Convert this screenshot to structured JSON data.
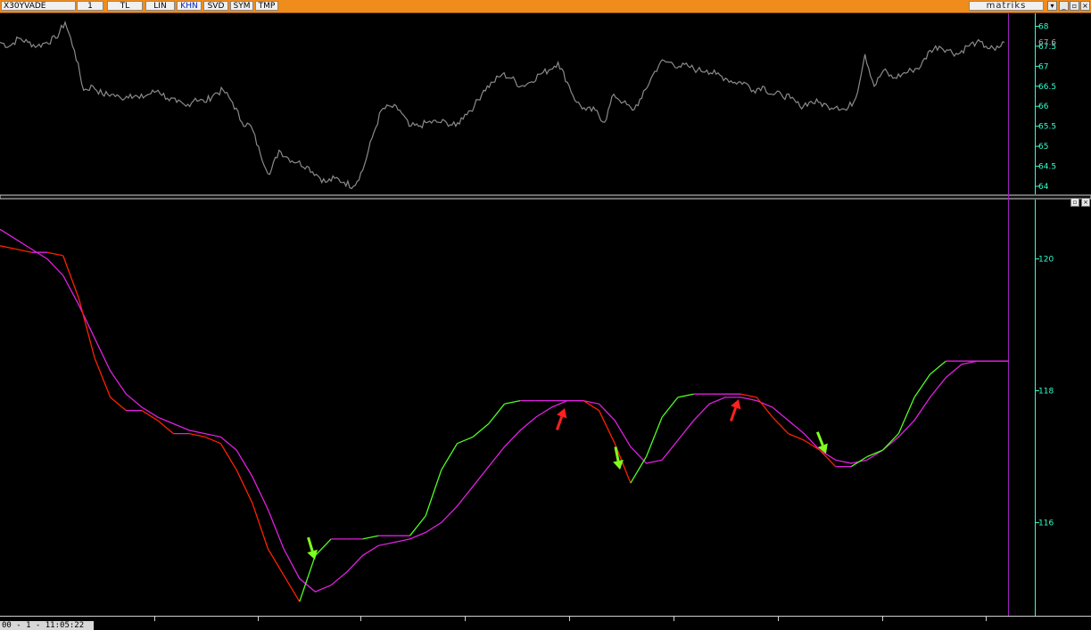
{
  "toolbar": {
    "symbol": "X30YVADE",
    "interval": "1",
    "buttons": [
      "TL",
      "LIN",
      "KHN",
      "SVD",
      "SYM",
      "TMP"
    ],
    "active_button": "KHN",
    "brand": "matriks",
    "win_buttons": [
      "▾",
      "_",
      "▫",
      "×"
    ]
  },
  "status": {
    "text": "00 - 1 - 11:05:22"
  },
  "pane_controls": [
    "▫",
    "×"
  ],
  "colors": {
    "background": "#000000",
    "toolbar": "#f08c1c",
    "price_line": "#8a8a8a",
    "axis": "#33ffcc",
    "magenta": "#e020e0",
    "up_line": "#50ff20",
    "down_line": "#ff2000",
    "arrow_green": "#80ff20",
    "arrow_red": "#ff2020"
  },
  "chart_data": [
    {
      "type": "line",
      "title": "",
      "ylim": [
        63.8,
        68.3
      ],
      "y_ticks": [
        68,
        67.5,
        67,
        66.5,
        66,
        65.5,
        65,
        64.5,
        64
      ],
      "last_value": "67.6",
      "grid": false,
      "series": [
        {
          "values": [
            67.6,
            67.5,
            67.7,
            67.6,
            67.5,
            67.6,
            67.7,
            68.1,
            67.4,
            66.4,
            66.5,
            66.3,
            66.3,
            66.2,
            66.3,
            66.2,
            66.3,
            66.4,
            66.2,
            66.1,
            66.0,
            66.2,
            66.1,
            66.3,
            66.4,
            66.1,
            65.6,
            65.5,
            64.8,
            64.3,
            64.9,
            64.7,
            64.6,
            64.5,
            64.3,
            64.1,
            64.2,
            64.1,
            64.0,
            64.4,
            65.2,
            65.9,
            66.0,
            65.9,
            65.5,
            65.5,
            65.6,
            65.6,
            65.6,
            65.5,
            65.8,
            66.0,
            66.4,
            66.6,
            66.8,
            66.7,
            66.5,
            66.6,
            66.8,
            66.9,
            67.1,
            66.6,
            66.1,
            65.9,
            65.9,
            65.6,
            66.3,
            66.1,
            65.9,
            66.2,
            66.7,
            67.1,
            67.1,
            67.0,
            67.0,
            66.9,
            66.9,
            66.8,
            66.7,
            66.6,
            66.6,
            66.4,
            66.5,
            66.3,
            66.3,
            66.2,
            66.0,
            66.1,
            66.1,
            66.0,
            66.0,
            65.9,
            66.2,
            67.3,
            66.5,
            66.9,
            66.7,
            66.8,
            66.9,
            67.0,
            67.4,
            67.5,
            67.4,
            67.3,
            67.5,
            67.6,
            67.5,
            67.4,
            67.6
          ]
        }
      ]
    },
    {
      "type": "line",
      "title": "",
      "ylim": [
        114.6,
        120.9
      ],
      "y_ticks": [
        120,
        118,
        116
      ],
      "x_tick_labels": [
        "00 - 1 - 11:05:22"
      ],
      "grid": false,
      "series": [
        {
          "color": "magenta",
          "values": [
            120.45,
            120.3,
            120.15,
            120.0,
            119.75,
            119.3,
            118.8,
            118.3,
            117.95,
            117.75,
            117.6,
            117.5,
            117.4,
            117.35,
            117.3,
            117.1,
            116.7,
            116.2,
            115.6,
            115.15,
            114.95,
            115.05,
            115.25,
            115.5,
            115.65,
            115.7,
            115.75,
            115.85,
            116.0,
            116.25,
            116.55,
            116.85,
            117.15,
            117.4,
            117.6,
            117.75,
            117.85,
            117.85,
            117.8,
            117.55,
            117.15,
            116.9,
            116.95,
            117.25,
            117.55,
            117.8,
            117.9,
            117.9,
            117.85,
            117.75,
            117.55,
            117.35,
            117.1,
            116.95,
            116.9,
            116.95,
            117.1,
            117.3,
            117.55,
            117.9,
            118.2,
            118.4,
            118.45,
            118.45,
            118.45
          ]
        },
        {
          "color": "green-red",
          "values": [
            120.2,
            120.15,
            120.1,
            120.1,
            120.05,
            119.4,
            118.5,
            117.9,
            117.7,
            117.7,
            117.55,
            117.35,
            117.35,
            117.3,
            117.2,
            116.8,
            116.3,
            115.6,
            115.2,
            114.8,
            115.5,
            115.75,
            115.75,
            115.75,
            115.8,
            115.8,
            115.8,
            116.1,
            116.8,
            117.2,
            117.3,
            117.5,
            117.8,
            117.85,
            117.85,
            117.85,
            117.85,
            117.85,
            117.7,
            117.2,
            116.6,
            117.0,
            117.6,
            117.9,
            117.95,
            117.95,
            117.95,
            117.95,
            117.9,
            117.6,
            117.35,
            117.25,
            117.1,
            116.85,
            116.85,
            117.0,
            117.1,
            117.35,
            117.9,
            118.25,
            118.45,
            118.45,
            118.45,
            118.45,
            118.45
          ]
        }
      ]
    }
  ]
}
